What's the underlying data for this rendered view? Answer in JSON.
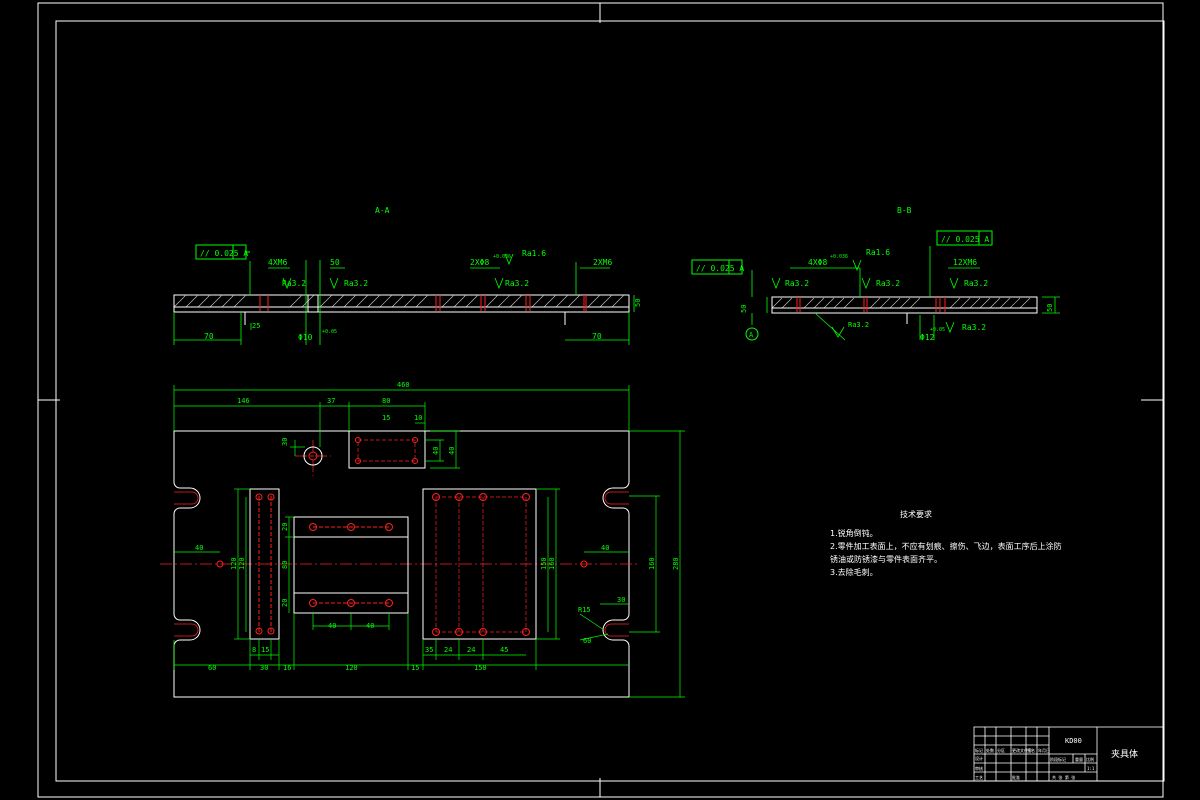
{
  "sections": {
    "a_title": "A-A",
    "b_title": "B-B"
  },
  "section_a": {
    "tol_frame": "// 0.025 A",
    "holes_4m": "4XM6",
    "depth_50": "50",
    "ra_a1": "Ra3.2",
    "ra_a2": "Ra3.2",
    "ra_a3": "Ra1.6",
    "ra_a4": "Ra3.2",
    "holes_2phi": "2XΦ8",
    "fit_2phi": "+0.036",
    "holes_2m": "2XM6",
    "thick": "50",
    "dim_left": "70",
    "dim_mid": "25",
    "dim_dia": "Φ10",
    "dim_dia_tol": "+0.05",
    "dim_right": "70"
  },
  "section_b": {
    "tol_frame1": "// 0.025 A",
    "tol_frame2": "// 0.025 A",
    "holes_4phi": "4XΦ8",
    "fit_4phi": "+0.036",
    "ra_b1": "Ra1.6",
    "ra_b2": "Ra3.2",
    "ra_b3": "Ra3.2",
    "ra_b4": "Ra3.2",
    "ra_b5": "Ra3.2",
    "ra_b6": "Ra3.2",
    "holes_12m": "12XM6",
    "dim_left": "50",
    "thick": "50",
    "dim_dia": "Φ12",
    "dim_dia_tol": "+0.05",
    "datum": "A"
  },
  "plan": {
    "overall_w": "460",
    "d146": "146",
    "d37": "37",
    "d80": "80",
    "d10": "10",
    "d15": "15",
    "d30": "30",
    "d40v": "40",
    "d40l": "40",
    "d40r": "40",
    "d30r": "30",
    "d120l": "120",
    "d150r": "150",
    "d160": "160",
    "d160b": "160",
    "overall_h": "280",
    "d20a": "20",
    "d80m": "80",
    "d20b": "20",
    "d40m1": "40",
    "d40m2": "40",
    "r15": "R15",
    "d30s": "30",
    "b60": "60",
    "b8": "8",
    "b15": "15",
    "b30": "30",
    "b16": "16",
    "b120": "120",
    "b15b": "15",
    "b35": "35",
    "b24a": "24",
    "b24b": "24",
    "b45": "45",
    "b150": "150"
  },
  "tech": {
    "title": "技术要求",
    "line1": "1.锐角倒钝。",
    "line2": "2.零件加工表面上，不应有划痕、擦伤、飞边，表面工序后上涂防",
    "line3": "锈油或防锈漆与零件表面齐平。",
    "line4": "3.去除毛刺。"
  },
  "titleblock": {
    "drawing_no": "KD00",
    "name": "夹具体",
    "r1c1": "标记",
    "r1c2": "处数",
    "r1c3": "分区",
    "r1c4": "更改文件号",
    "r1c5": "签名",
    "r1c6": "年月日",
    "design": "设计",
    "review": "审核",
    "craft": "工艺",
    "approve": "批准",
    "stage_mark": "阶段标记",
    "weight": "重量",
    "scale": "比例",
    "sheet": "共 张 第 张",
    "scale_val": "1:1"
  }
}
